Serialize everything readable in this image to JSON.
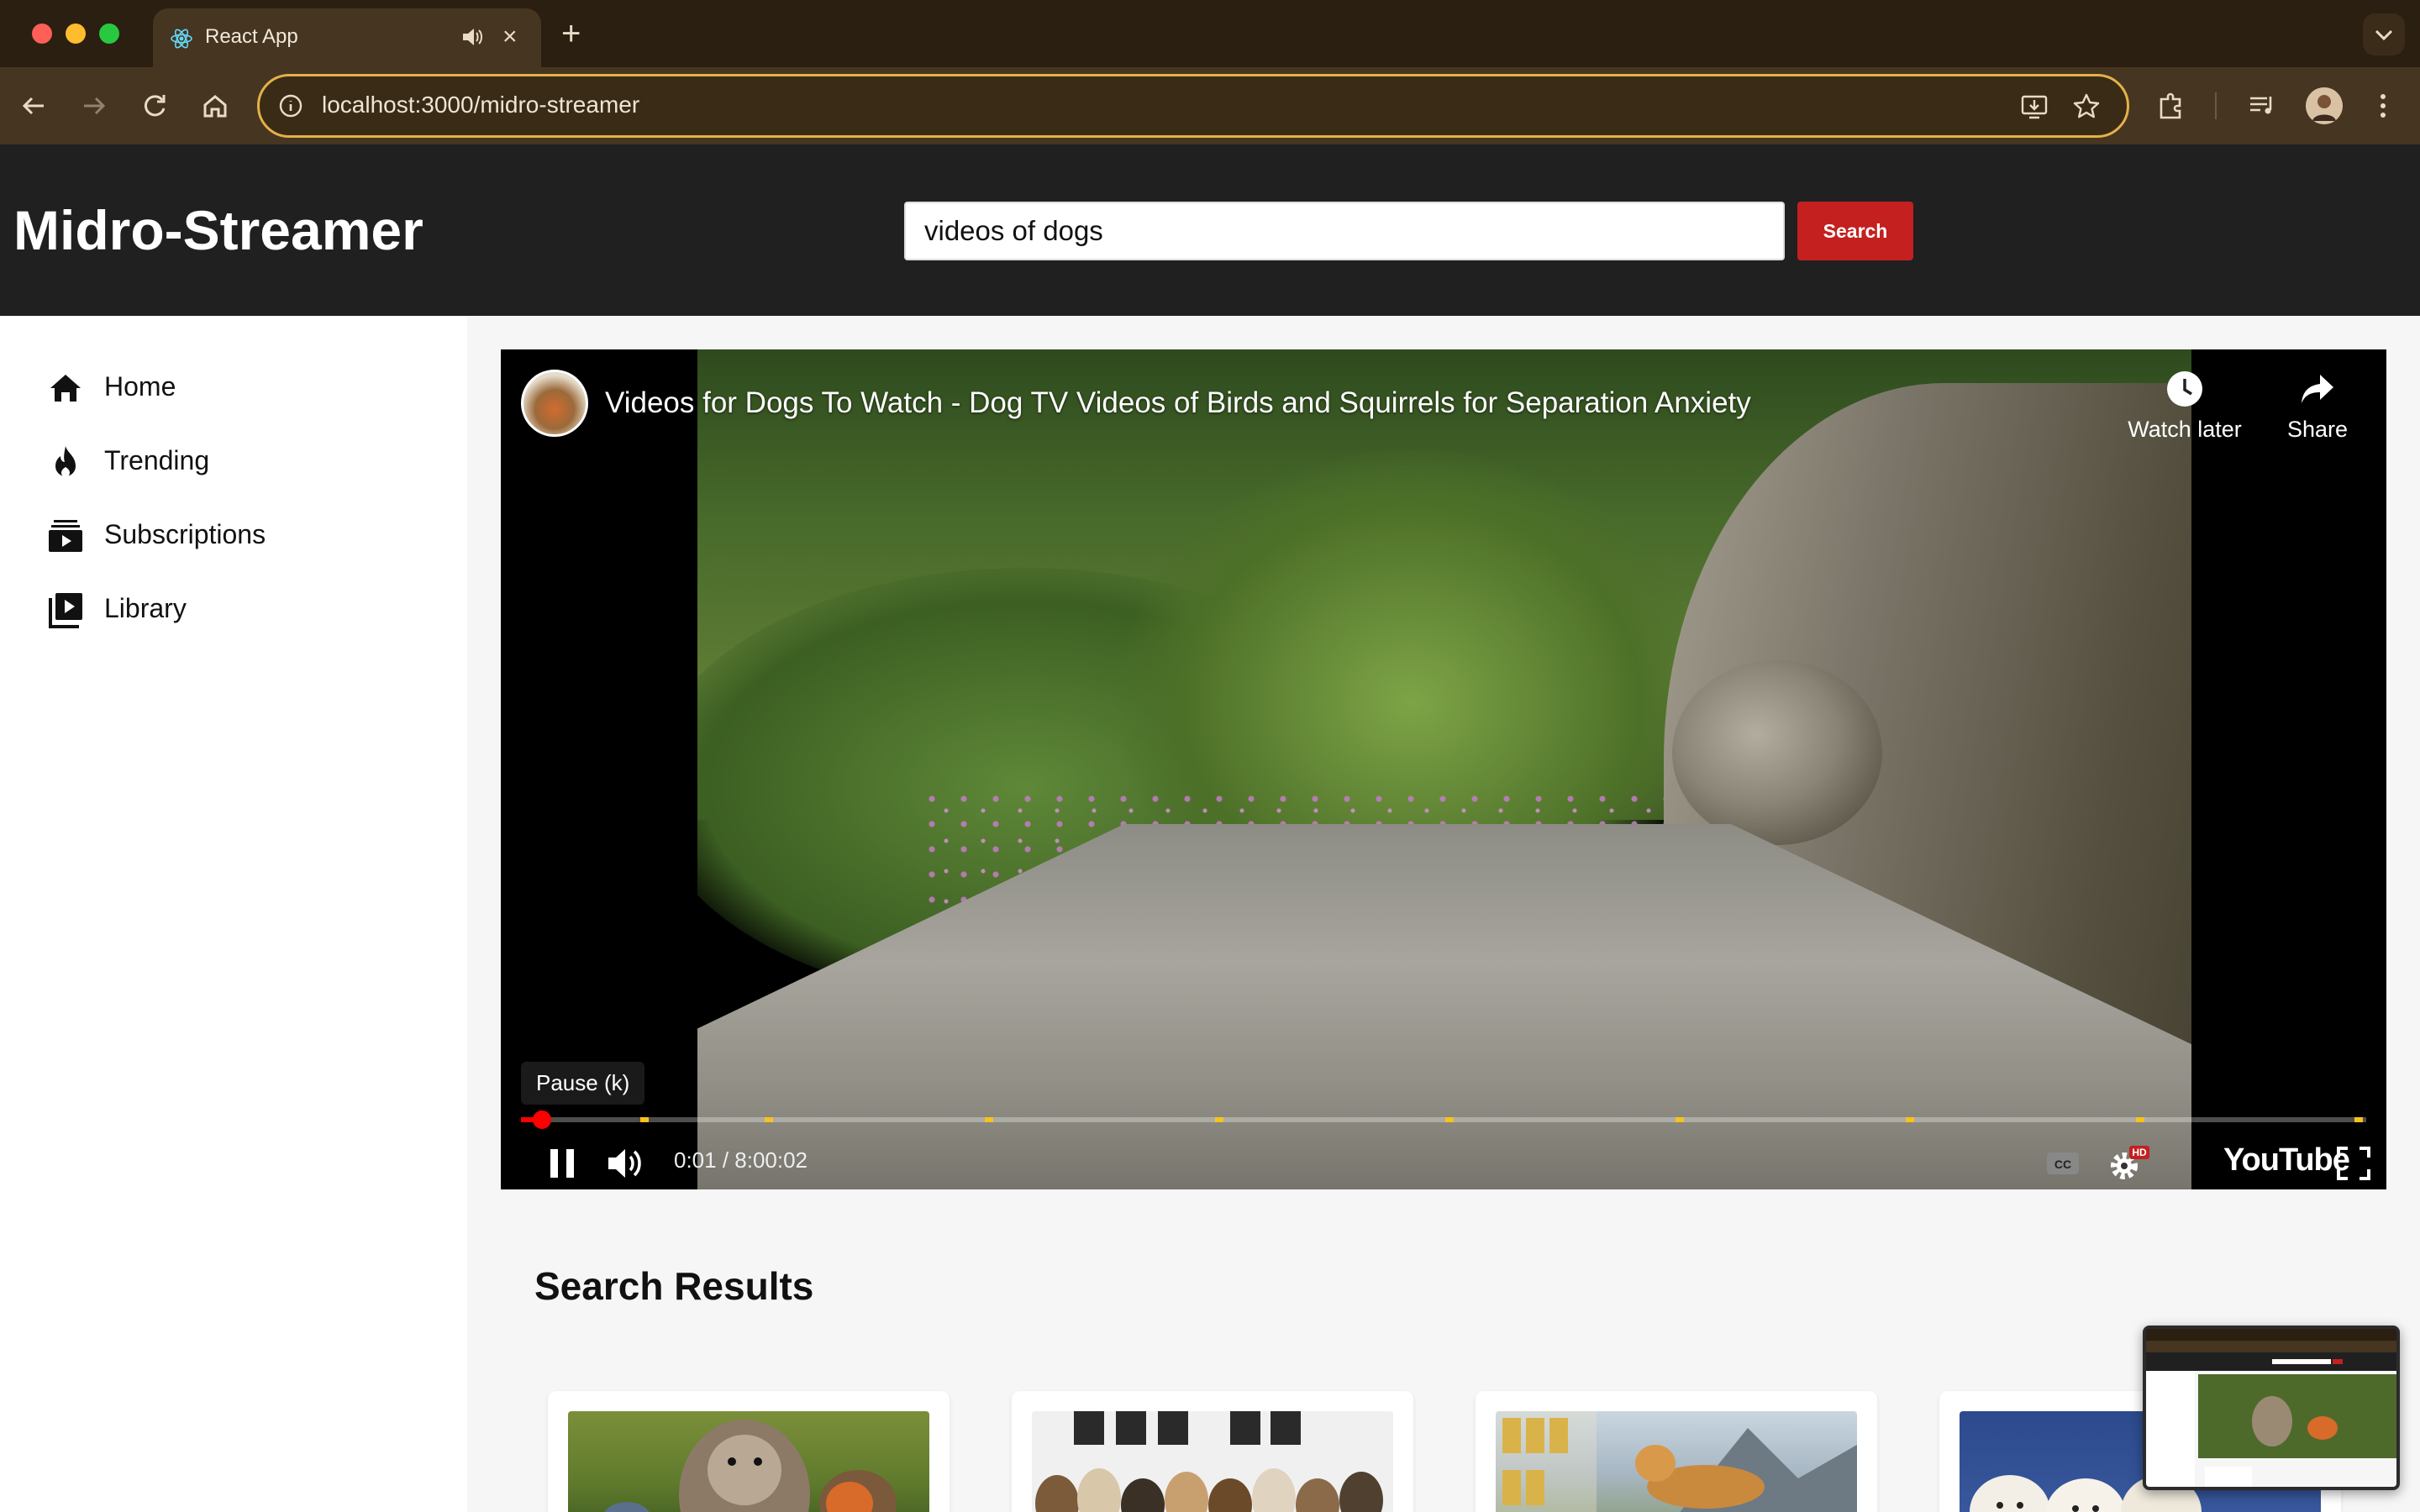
{
  "browser": {
    "tab_title": "React App",
    "url": "localhost:3000/midro-streamer",
    "new_tab_symbol": "+",
    "close_symbol": "×"
  },
  "app": {
    "brand": "Midro-Streamer",
    "search_value": "videos of dogs",
    "search_button": "Search"
  },
  "sidebar": {
    "items": [
      {
        "label": "Home",
        "icon": "home-icon"
      },
      {
        "label": "Trending",
        "icon": "flame-icon"
      },
      {
        "label": "Subscriptions",
        "icon": "subscriptions-icon"
      },
      {
        "label": "Library",
        "icon": "library-icon"
      }
    ]
  },
  "player": {
    "title": "Videos for Dogs To Watch - Dog TV Videos of Birds and Squirrels for Separation Anxiety",
    "watch_later": "Watch later",
    "share": "Share",
    "tooltip": "Pause (k)",
    "time": "0:01 / 8:00:02",
    "logo": "YouTube",
    "hd_badge": "HD",
    "progress_fraction": 0.0003
  },
  "results": {
    "title": "Search Results"
  },
  "colors": {
    "accent_red": "#c4201f",
    "header_bg": "#202020",
    "omnibox_border": "#e3b14a"
  }
}
